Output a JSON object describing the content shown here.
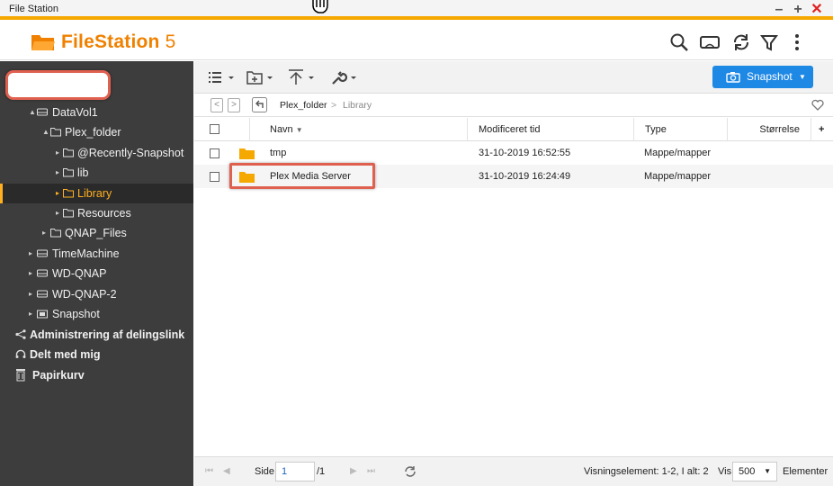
{
  "window": {
    "title": "File Station",
    "controls": [
      "–",
      "+",
      "✕"
    ]
  },
  "header": {
    "app_name": "FileStation",
    "app_version": "5",
    "icons": [
      "search-icon",
      "media-icon",
      "refresh-icon",
      "filter-icon",
      "more-icon"
    ]
  },
  "sidebar": {
    "search_value": "",
    "items": [
      {
        "label": "DataVol1",
        "icon": "drive-icon"
      },
      {
        "label": "Plex_folder",
        "icon": "folder-icon"
      },
      {
        "label": "@Recently-Snapshot",
        "icon": "folder-icon"
      },
      {
        "label": "lib",
        "icon": "folder-icon"
      },
      {
        "label": "Library",
        "icon": "folder-icon",
        "selected": true
      },
      {
        "label": "Resources",
        "icon": "folder-icon"
      },
      {
        "label": "QNAP_Files",
        "icon": "folder-icon"
      },
      {
        "label": "TimeMachine",
        "icon": "drive-icon"
      },
      {
        "label": "WD-QNAP",
        "icon": "drive-icon"
      },
      {
        "label": "WD-QNAP-2",
        "icon": "drive-icon"
      },
      {
        "label": "Snapshot",
        "icon": "snapshot-icon"
      },
      {
        "label": "Administrering af delingslink",
        "icon": "share-icon"
      },
      {
        "label": "Delt med mig",
        "icon": "shared-icon"
      },
      {
        "label": "Papirkurv",
        "icon": "trash-icon"
      }
    ]
  },
  "toolbar": {
    "snapshot_label": "Snapshot",
    "accent": "#1e88e5"
  },
  "breadcrumb": {
    "parent": "Plex_folder",
    "separator": ">",
    "current": "Library"
  },
  "table": {
    "columns": [
      "Navn",
      "Modificeret tid",
      "Type",
      "Størrelse",
      "+"
    ],
    "rows": [
      {
        "name": "tmp",
        "modified": "31-10-2019 16:52:55",
        "type": "Mappe/mapper",
        "size": ""
      },
      {
        "name": "Plex Media Server",
        "modified": "31-10-2019 16:24:49",
        "type": "Mappe/mapper",
        "size": ""
      }
    ]
  },
  "footer": {
    "page_label": "Side",
    "page_value": "1",
    "page_total": "/1",
    "display_info": "Visningselement: 1-2, I alt: 2",
    "show_label": "Vis",
    "per_page": "500",
    "elements_label": "Elementer"
  },
  "colors": {
    "brand": "#f08000",
    "accent_bar": "#f6a800",
    "highlight": "#e06050"
  }
}
